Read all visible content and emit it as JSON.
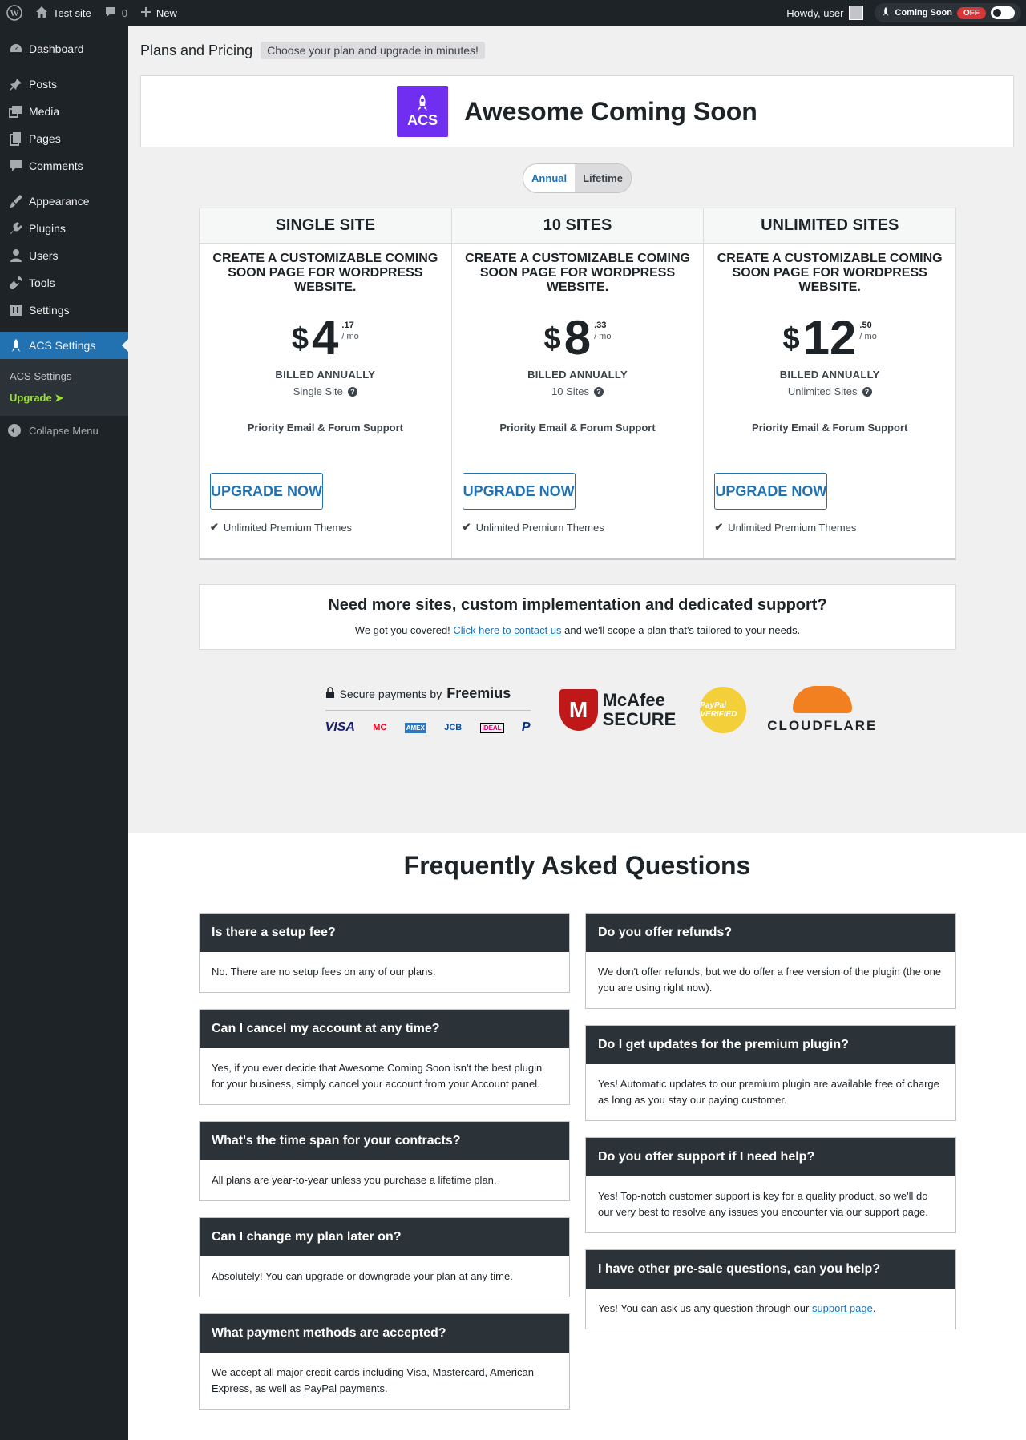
{
  "admin_bar": {
    "site_name": "Test site",
    "comments_count": "0",
    "new_label": "New",
    "howdy": "Howdy, user",
    "coming_soon_label": "Coming Soon",
    "coming_soon_status": "OFF"
  },
  "sidebar": {
    "items": [
      {
        "label": "Dashboard",
        "icon": "dashboard-icon"
      },
      {
        "label": "Posts",
        "icon": "pin-icon"
      },
      {
        "label": "Media",
        "icon": "media-icon"
      },
      {
        "label": "Pages",
        "icon": "pages-icon"
      },
      {
        "label": "Comments",
        "icon": "comment-icon"
      },
      {
        "label": "Appearance",
        "icon": "brush-icon"
      },
      {
        "label": "Plugins",
        "icon": "plug-icon"
      },
      {
        "label": "Users",
        "icon": "user-icon"
      },
      {
        "label": "Tools",
        "icon": "wrench-icon"
      },
      {
        "label": "Settings",
        "icon": "settings-icon"
      },
      {
        "label": "ACS Settings",
        "icon": "rocket-icon"
      }
    ],
    "submenu": [
      "ACS Settings",
      "Upgrade ➤"
    ],
    "collapse": "Collapse Menu"
  },
  "header": {
    "title": "Plans and Pricing",
    "tagline": "Choose your plan and upgrade in minutes!"
  },
  "brand": {
    "logo_text": "ACS",
    "name": "Awesome Coming Soon"
  },
  "billing": {
    "options": [
      "Annual",
      "Lifetime"
    ],
    "selected": "Lifetime"
  },
  "plans": [
    {
      "name": "SINGLE SITE",
      "desc": "CREATE A CUSTOMIZABLE COMING SOON PAGE FOR WORDPRESS WEBSITE.",
      "currency": "$",
      "amount": "4",
      "cents": ".17",
      "period": "/ mo",
      "billed": "BILLED ANNUALLY",
      "sites": "Single Site",
      "support": "Priority Email & Forum Support",
      "button": "UPGRADE NOW",
      "feature": "Unlimited Premium Themes"
    },
    {
      "name": "10 SITES",
      "desc": "CREATE A CUSTOMIZABLE COMING SOON PAGE FOR WORDPRESS WEBSITE.",
      "currency": "$",
      "amount": "8",
      "cents": ".33",
      "period": "/ mo",
      "billed": "BILLED ANNUALLY",
      "sites": "10 Sites",
      "support": "Priority Email & Forum Support",
      "button": "UPGRADE NOW",
      "feature": "Unlimited Premium Themes"
    },
    {
      "name": "UNLIMITED SITES",
      "desc": "CREATE A CUSTOMIZABLE COMING SOON PAGE FOR WORDPRESS WEBSITE.",
      "currency": "$",
      "amount": "12",
      "cents": ".50",
      "period": "/ mo",
      "billed": "BILLED ANNUALLY",
      "sites": "Unlimited Sites",
      "support": "Priority Email & Forum Support",
      "button": "UPGRADE NOW",
      "feature": "Unlimited Premium Themes"
    }
  ],
  "custom": {
    "heading": "Need more sites, custom implementation and dedicated support?",
    "text_before": "We got you covered! ",
    "link": "Click here to contact us",
    "text_after": " and we'll scope a plan that's tailored to your needs."
  },
  "trust": {
    "secure_text": "Secure payments by",
    "freemius": "Freemius",
    "cards": [
      "VISA",
      "MC",
      "AMEX",
      "JCB",
      "iDEAL",
      "P"
    ],
    "mcafee_1": "McAfee",
    "mcafee_2": "SECURE",
    "paypal_badge": "PayPal VERIFIED",
    "cloudflare": "CLOUDFLARE"
  },
  "faq": {
    "title": "Frequently Asked Questions",
    "left": [
      {
        "q": "Is there a setup fee?",
        "a": "No. There are no setup fees on any of our plans."
      },
      {
        "q": "Can I cancel my account at any time?",
        "a": "Yes, if you ever decide that Awesome Coming Soon isn't the best plugin for your business, simply cancel your account from your Account panel."
      },
      {
        "q": "What's the time span for your contracts?",
        "a": "All plans are year-to-year unless you purchase a lifetime plan."
      },
      {
        "q": "Can I change my plan later on?",
        "a": "Absolutely! You can upgrade or downgrade your plan at any time."
      },
      {
        "q": "What payment methods are accepted?",
        "a": "We accept all major credit cards including Visa, Mastercard, American Express, as well as PayPal payments."
      }
    ],
    "right": [
      {
        "q": "Do you offer refunds?",
        "a": "We don't offer refunds, but we do offer a free version of the plugin (the one you are using right now)."
      },
      {
        "q": "Do I get updates for the premium plugin?",
        "a": "Yes! Automatic updates to our premium plugin are available free of charge as long as you stay our paying customer."
      },
      {
        "q": "Do you offer support if I need help?",
        "a": "Yes! Top-notch customer support is key for a quality product, so we'll do our very best to resolve any issues you encounter via our support page."
      },
      {
        "q": "I have other pre-sale questions, can you help?",
        "a_before": "Yes! You can ask us any question through our ",
        "a_link": "support page",
        "a_after": "."
      }
    ]
  }
}
